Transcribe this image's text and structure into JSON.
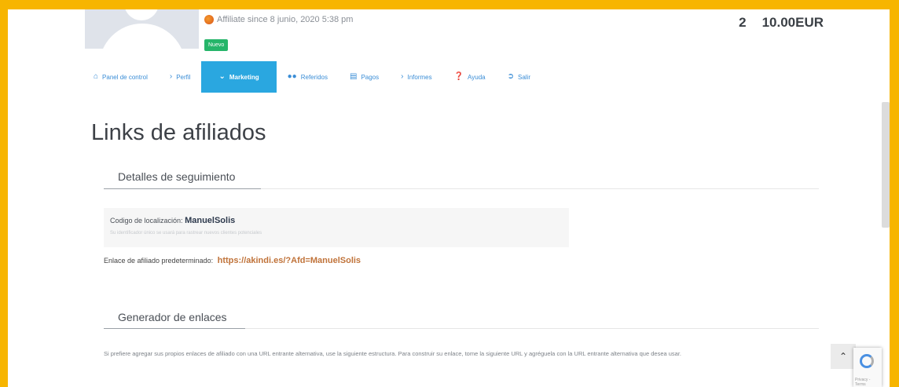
{
  "profile": {
    "affiliate_since": "Affiliate since 8 junio, 2020 5:38 pm",
    "badge": "Nuevo",
    "balance_count": "2",
    "balance_amount": "10.00EUR"
  },
  "nav": {
    "items": [
      {
        "label": "Panel de control",
        "icon": "home-icon"
      },
      {
        "label": "Perfil",
        "icon": "chevron-right-icon"
      },
      {
        "label": "Marketing",
        "icon": "chevron-down-icon"
      },
      {
        "label": "Referidos",
        "icon": "users-icon"
      },
      {
        "label": "Pagos",
        "icon": "payment-card-icon"
      },
      {
        "label": "Informes",
        "icon": "chevron-right-icon"
      },
      {
        "label": "Ayuda",
        "icon": "help-icon"
      },
      {
        "label": "Salir",
        "icon": "sign-out-icon"
      }
    ],
    "active": "Marketing"
  },
  "page": {
    "title": "Links de afiliados"
  },
  "tracking": {
    "section_title": "Detalles de seguimiento",
    "code_label": "Codigo de localización:",
    "code_value": "ManuelSolis",
    "code_help": "Su identificador único se usará para rastrear nuevos clientes potenciales",
    "default_link_label": "Enlace de afiliado predeterminado:",
    "default_link_url": "https://akindi.es/?Afd=ManuelSolis"
  },
  "generator": {
    "section_title": "Generador de enlaces",
    "description": "Si prefiere agregar sus propios enlaces de afiliado con una URL entrante alternativa, use la siguiente estructura. Para construir su enlace, tome la siguiente URL y agréguela con la URL entrante alternativa que desea usar."
  },
  "widgets": {
    "scroll_top_icon": "chevron-up-icon",
    "recaptcha_text": "Privacy - Terms"
  },
  "colors": {
    "frame": "#f7b500",
    "nav_active": "#2aa7e0",
    "nav_link": "#3a8dd6",
    "badge": "#26b56a",
    "url": "#c0733a"
  }
}
